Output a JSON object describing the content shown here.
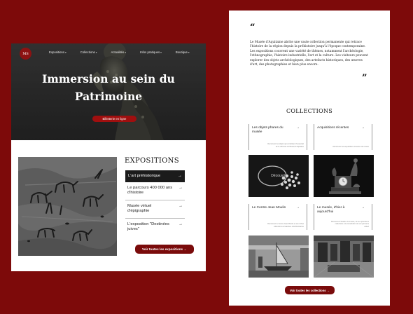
{
  "left_page": {
    "logo": {
      "text": "MS",
      "icon": "museum-logo"
    },
    "nav": [
      {
        "label": "Expositions"
      },
      {
        "label": "Collections"
      },
      {
        "label": "Actualités"
      },
      {
        "label": "Infos pratiques"
      },
      {
        "label": "Boutique"
      }
    ],
    "hero": {
      "title_line1": "Immersion au sein du",
      "title_line2": "Patrimoine",
      "cta_label": "Billetterie en ligne"
    },
    "expositions": {
      "heading": "EXPOSITIONS",
      "items": [
        {
          "label": "L'art préhistorique"
        },
        {
          "label": "Le parcours 400 000 ans d'histoire"
        },
        {
          "label": "Musée virtuel d'épigraphie"
        },
        {
          "label": "L'exposition \"Destinées juives\""
        }
      ],
      "button_label": "Voir toutes les expositions →"
    }
  },
  "right_page": {
    "quote": {
      "open_mark": "“",
      "close_mark": "”",
      "text": "Le Musée d'Aquitaine abrite une vaste collection permanente qui retrace l'histoire de la région depuis la préhistoire jusqu'à l'époque contemporaine. Les expositions couvrent une variété de thèmes, notamment l'archéologie, l'ethnographie, l'histoire industrielle, l'art et la culture. Les visiteurs peuvent explorer des objets archéologiques, des artefacts historiques, des œuvres d'art, des photographies et bien plus encore."
    },
    "collections": {
      "heading": "COLLECTIONS",
      "cards": [
        {
          "title": "Les objets phares du musée",
          "desc": "Découvrez les objets qui constituent l'essentiel de la richesse du Musée d'Aquitaine"
        },
        {
          "title": "Acquisitions récentes",
          "desc": "Découvrez les acquisitions récentes du musée"
        },
        {
          "title": "Le Centre Jean Moulin",
          "desc": "Découvrez le Centre Jean Moulin et ses riches collections consacrées à la Résistance"
        },
        {
          "title": "Le musée, d'hier à aujourd'hui",
          "desc": "Découvrez l'histoire du musée, de ses premières collections à la constitution de son parcours actuel"
        }
      ],
      "photo_label": "Découvrir",
      "button_label": "Voir toutes les collections →"
    }
  },
  "colors": {
    "background": "#7d0a0a",
    "accent": "#a00f0f",
    "button": "#7a0b0b"
  }
}
